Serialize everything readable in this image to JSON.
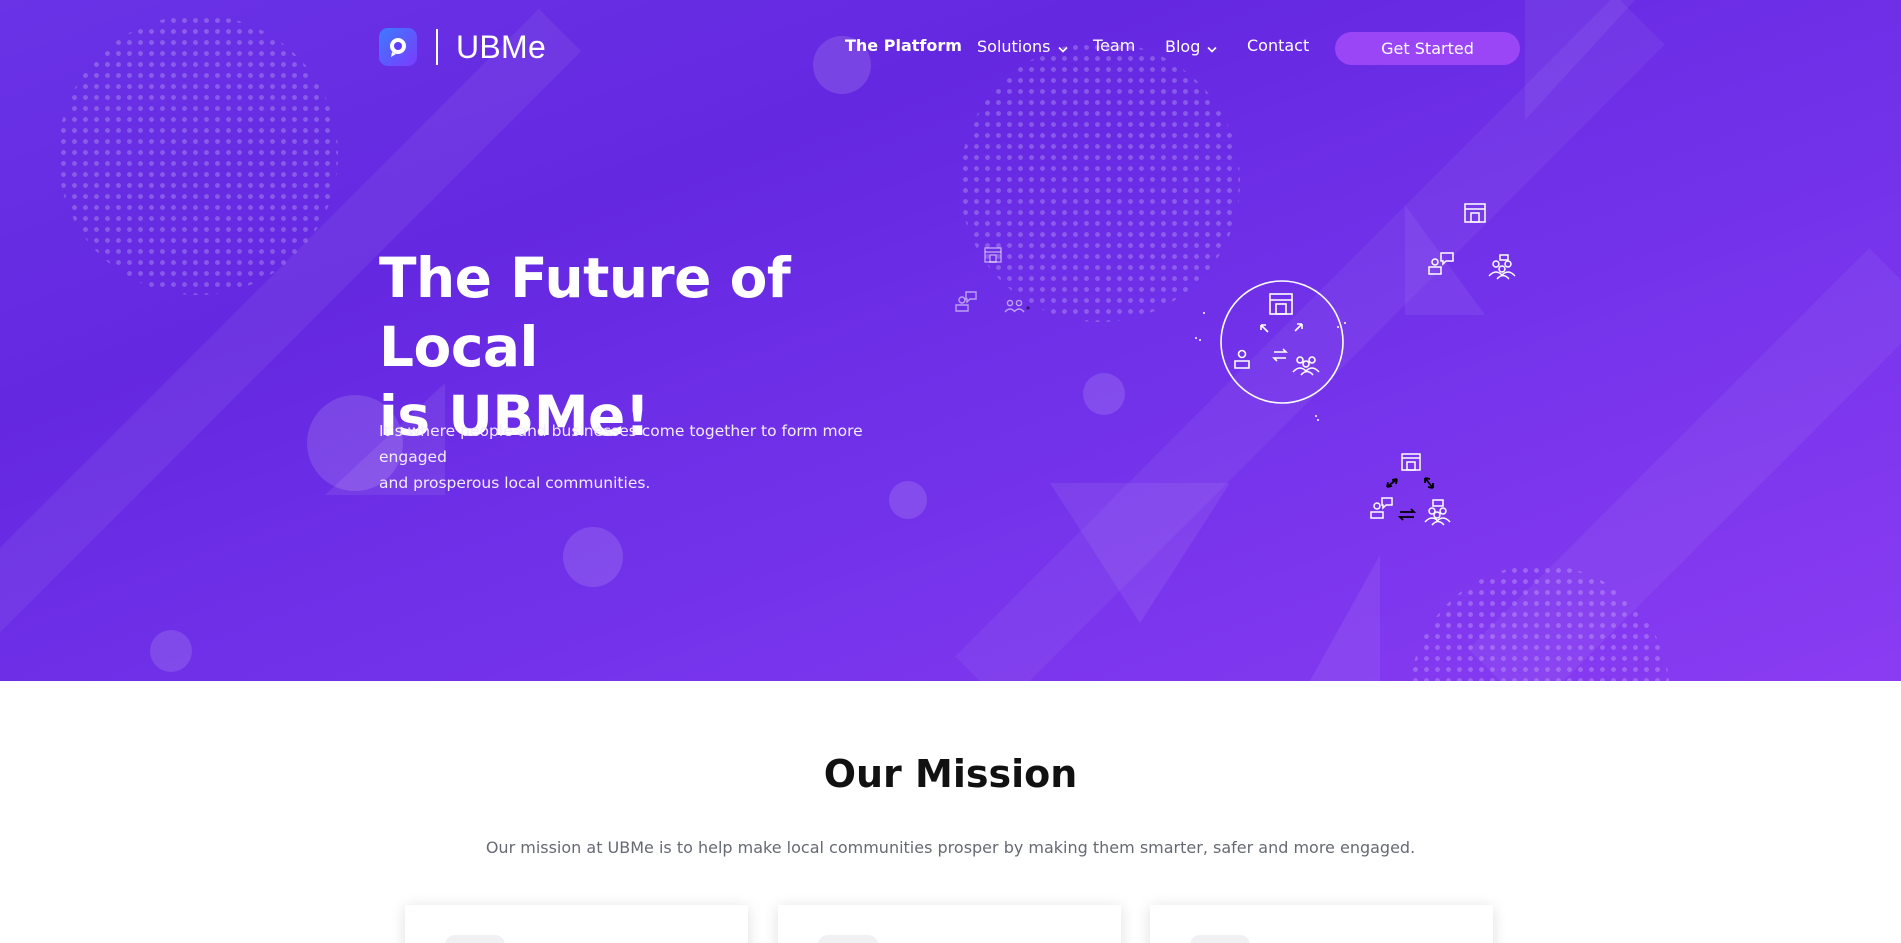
{
  "brand": {
    "name": "UBMe",
    "logo_icon": "location-pin-icon",
    "accent": "#6a33e6",
    "cta_color": "#9a46f6"
  },
  "nav": {
    "items": [
      {
        "label": "The Platform",
        "active": true,
        "dropdown": false
      },
      {
        "label": "Solutions",
        "active": false,
        "dropdown": true
      },
      {
        "label": "Team",
        "active": false,
        "dropdown": false
      },
      {
        "label": "Blog",
        "active": false,
        "dropdown": true
      },
      {
        "label": "Contact",
        "active": false,
        "dropdown": false
      }
    ],
    "cta_label": "Get Started"
  },
  "hero": {
    "title_line1": "The Future of Local",
    "title_line2": "is UBMe!",
    "subtitle_line1": "It’s where people and businesses come together to form more engaged",
    "subtitle_line2": "and prosperous local communities.",
    "illustration_icons": [
      "store-icon",
      "person-chat-icon",
      "group-icon",
      "exchange-arrows-icon"
    ]
  },
  "mission": {
    "title": "Our Mission",
    "text": "Our mission at UBMe is to help make local communities prosper by making them smarter, safer and more engaged."
  }
}
